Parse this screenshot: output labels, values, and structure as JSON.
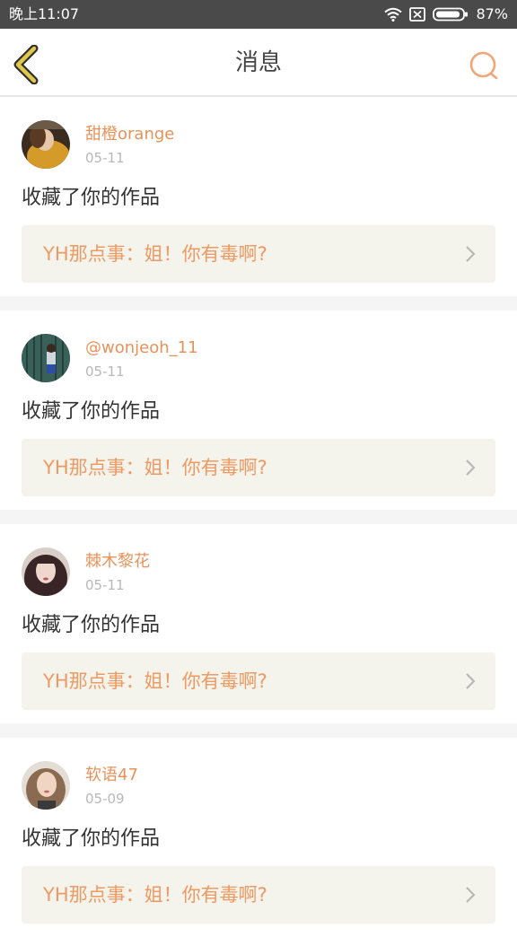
{
  "status_bar": {
    "time": "晚上11:07",
    "wifi_icon": "wifi-icon",
    "sim_icon": "no-sim-icon",
    "battery_icon": "battery-icon",
    "battery": "87%"
  },
  "nav": {
    "back_icon": "chevron-left-icon",
    "title": "消息",
    "search_icon": "search-icon"
  },
  "colors": {
    "accent": "#e8925a",
    "back_icon": "#e2c84a",
    "link_bg": "#f4f3ec"
  },
  "messages": [
    {
      "username": "甜橙orange",
      "date": "05-11",
      "action": "收藏了你的作品",
      "work_title": "YH那点事：姐！你有毒啊?"
    },
    {
      "username": "@wonjeoh_11",
      "date": "05-11",
      "action": "收藏了你的作品",
      "work_title": "YH那点事：姐！你有毒啊?"
    },
    {
      "username": "棘木黎花",
      "date": "05-11",
      "action": "收藏了你的作品",
      "work_title": "YH那点事：姐！你有毒啊?"
    },
    {
      "username": "软语47",
      "date": "05-09",
      "action": "收藏了你的作品",
      "work_title": "YH那点事：姐！你有毒啊?"
    }
  ]
}
